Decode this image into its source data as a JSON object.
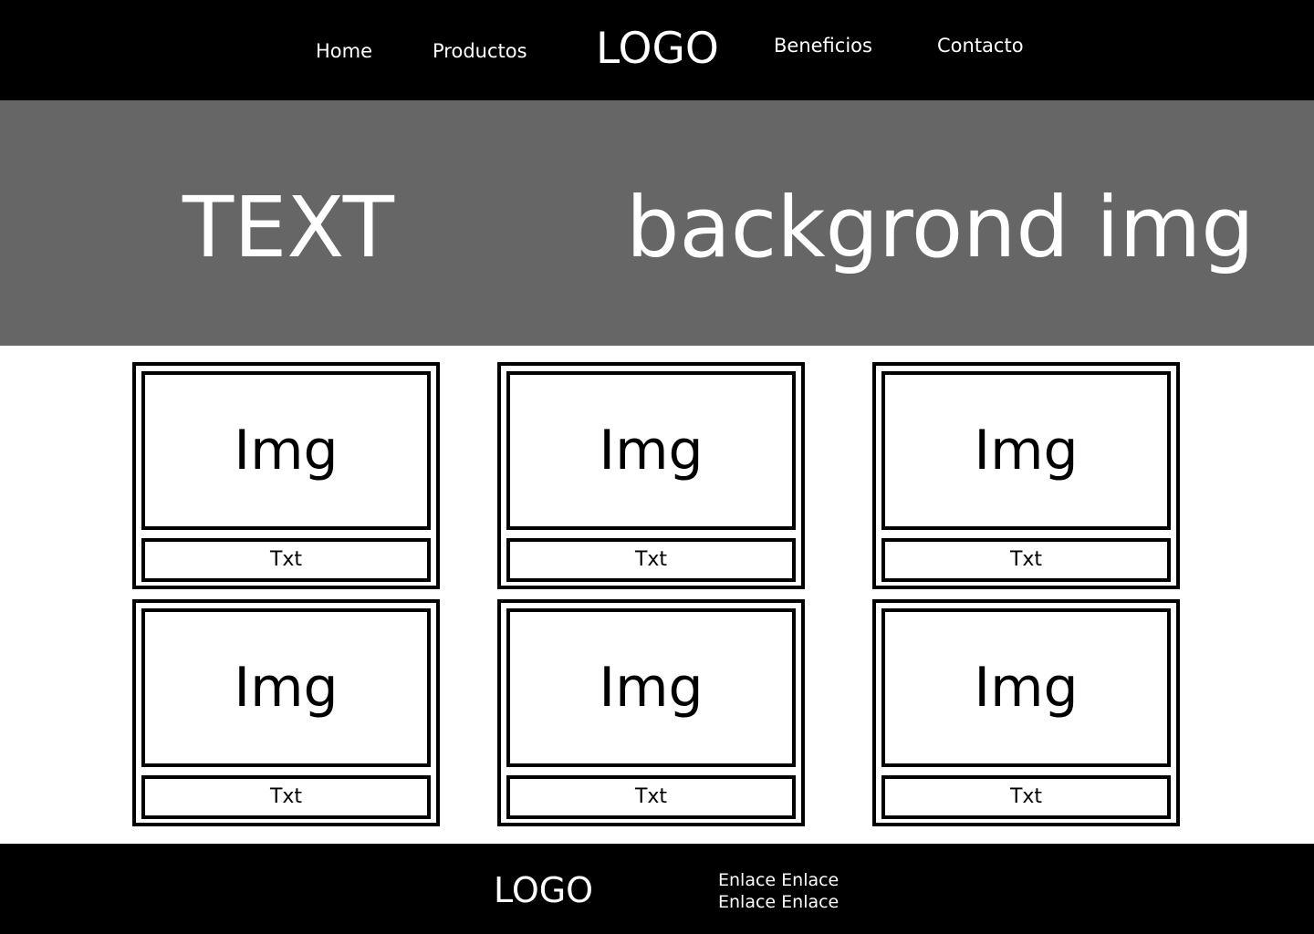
{
  "header": {
    "nav_left": [
      {
        "label": "Home"
      },
      {
        "label": "Productos"
      }
    ],
    "logo": "LOGO",
    "nav_right": [
      {
        "label": "Beneficios"
      },
      {
        "label": "Contacto"
      }
    ]
  },
  "hero": {
    "text": "TEXT",
    "background_label": "backgrond img"
  },
  "products": [
    {
      "image_label": "Img",
      "text": "Txt"
    },
    {
      "image_label": "Img",
      "text": "Txt"
    },
    {
      "image_label": "Img",
      "text": "Txt"
    },
    {
      "image_label": "Img",
      "text": "Txt"
    },
    {
      "image_label": "Img",
      "text": "Txt"
    },
    {
      "image_label": "Img",
      "text": "Txt"
    }
  ],
  "footer": {
    "logo": "LOGO",
    "links": [
      {
        "label": "Enlace Enlace"
      },
      {
        "label": "Enlace Enlace"
      }
    ]
  },
  "colors": {
    "header_bg": "#000000",
    "hero_bg": "#666666",
    "footer_bg": "#000000",
    "text_light": "#ffffff"
  }
}
